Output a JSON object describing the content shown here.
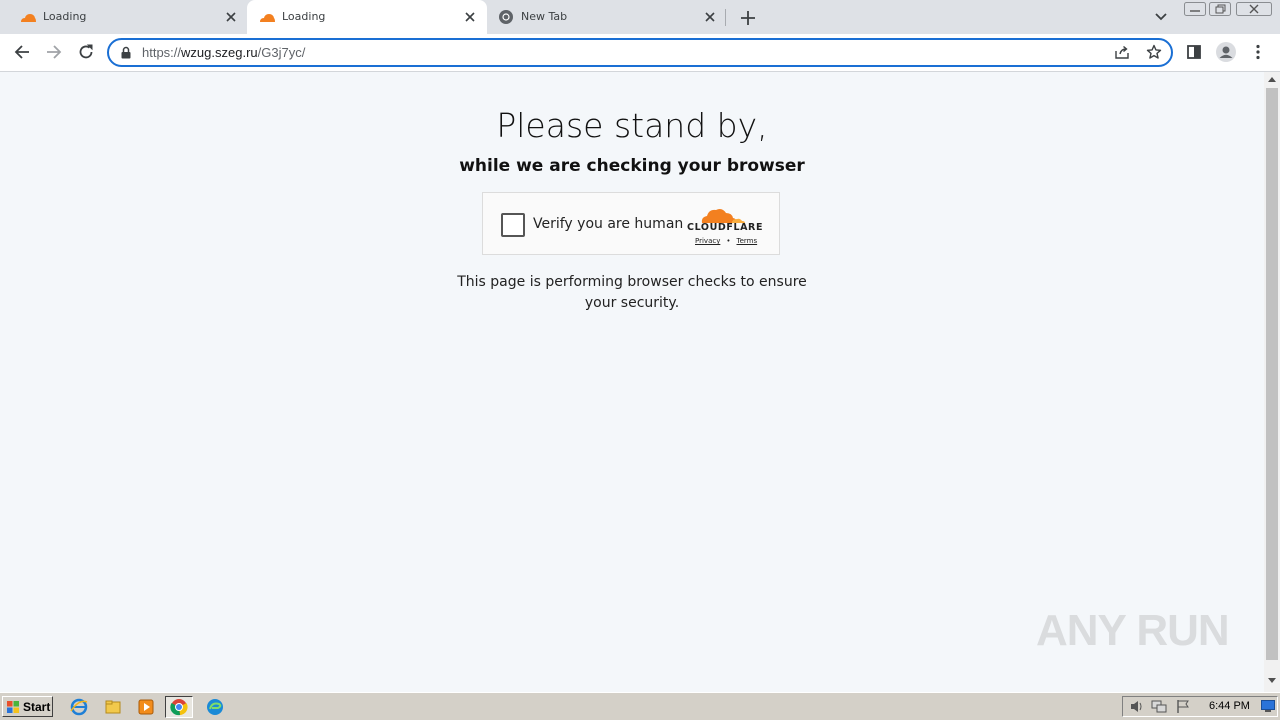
{
  "browser": {
    "tabs": [
      {
        "title": "Loading",
        "favicon": "cloudflare-icon",
        "active": false
      },
      {
        "title": "Loading",
        "favicon": "cloudflare-icon",
        "active": true
      },
      {
        "title": "New Tab",
        "favicon": "chrome-icon",
        "active": false
      }
    ],
    "address": {
      "scheme": "https://",
      "host": "wzug.szeg.ru",
      "path": "/G3j7yc/"
    }
  },
  "page": {
    "heading": "Please stand by,",
    "subheading": "while we are checking your browser",
    "widget": {
      "checkbox_label": "Verify you are human",
      "brand": "CLOUDFLARE",
      "privacy_link": "Privacy",
      "separator": "•",
      "terms_link": "Terms",
      "checked": false
    },
    "description_line1": "This page is performing browser checks to ensure",
    "description_line2": "your security."
  },
  "watermark": "ANY RUN",
  "taskbar": {
    "start_label": "Start",
    "clock": "6:44 PM",
    "quicklaunch": [
      "ie-icon",
      "explorer-icon",
      "media-player-icon",
      "chrome-icon",
      "edge-icon"
    ]
  },
  "colors": {
    "accent": "#1a6fd4",
    "cloudflare_orange": "#f38020",
    "page_bg": "#f4f7fa"
  }
}
